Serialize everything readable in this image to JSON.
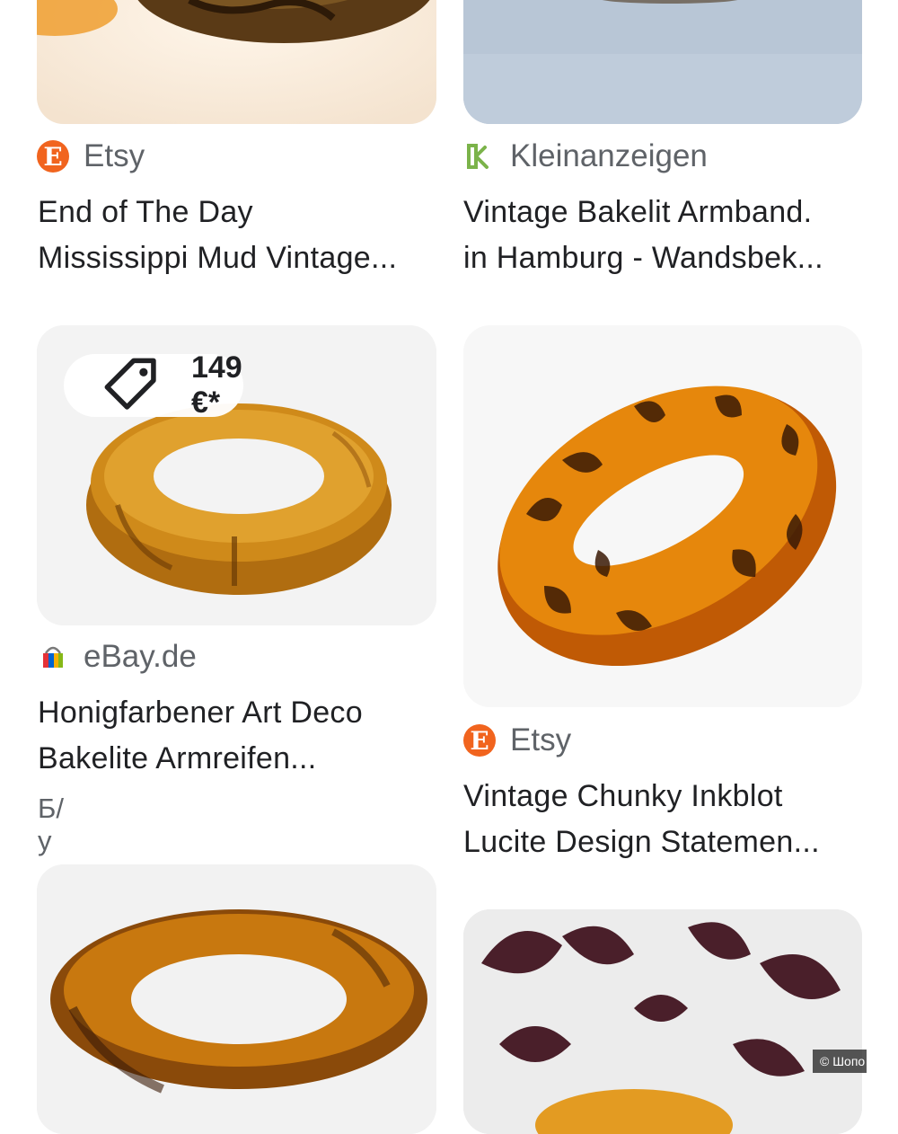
{
  "results": [
    {
      "source": "Etsy",
      "title_line1": "End of The Day",
      "title_line2": "Mississippi Mud Vintage..."
    },
    {
      "source": "Kleinanzeigen",
      "title_line1": "Vintage Bakelit Armband.",
      "title_line2": "in Hamburg - Wandsbek..."
    },
    {
      "price": "149 €*",
      "source": "eBay.de",
      "title_line1": "Honigfarbener Art Deco",
      "title_line2": "Bakelite Armreifen...",
      "condition": "Б/у"
    },
    {
      "source": "Etsy",
      "title_line1": "Vintage Chunky Inkblot",
      "title_line2": "Lucite Design Statemen..."
    }
  ],
  "copyright": "© Шопо",
  "colors": {
    "etsy_orange": "#f1641e",
    "kleinanzeigen_green": "#7bb34a",
    "text_primary": "#202124",
    "text_secondary": "#5f6368"
  }
}
